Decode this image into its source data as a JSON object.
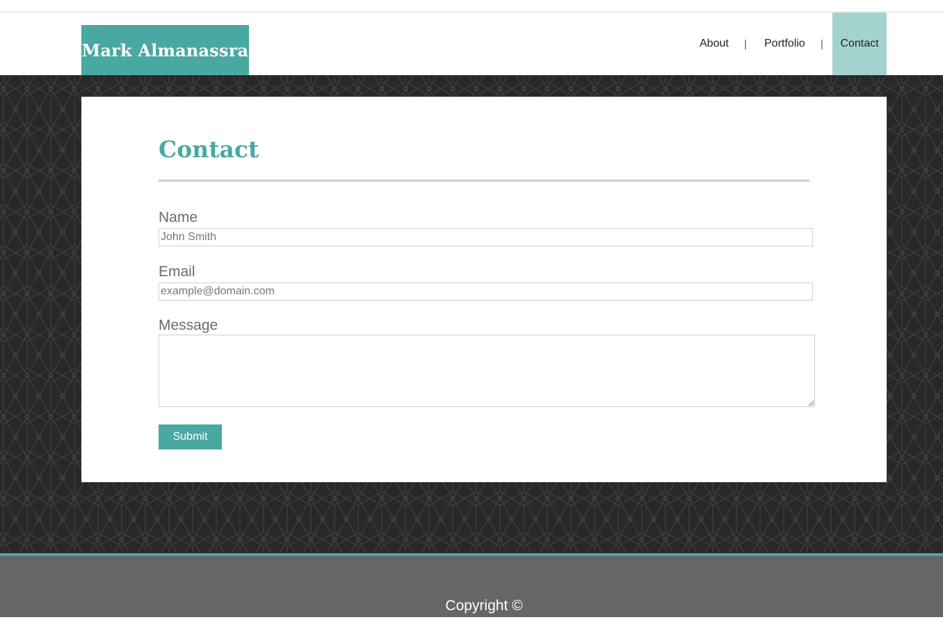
{
  "header": {
    "logo_text": "Mark Almanassra",
    "nav": [
      {
        "label": "About",
        "active": false
      },
      {
        "label": "Portfolio",
        "active": false
      },
      {
        "label": "Contact",
        "active": true
      }
    ],
    "separator": "|"
  },
  "main": {
    "title": "Contact",
    "form": {
      "name_label": "Name",
      "name_placeholder": "John Smith",
      "email_label": "Email",
      "email_placeholder": "example@domain.com",
      "message_label": "Message",
      "submit_label": "Submit"
    }
  },
  "footer": {
    "copyright": "Copyright ©"
  },
  "colors": {
    "accent": "#4aa8a2",
    "nav_active_bg": "#a2d3cf",
    "pattern_bg": "#282828",
    "footer_bg": "#666666"
  }
}
